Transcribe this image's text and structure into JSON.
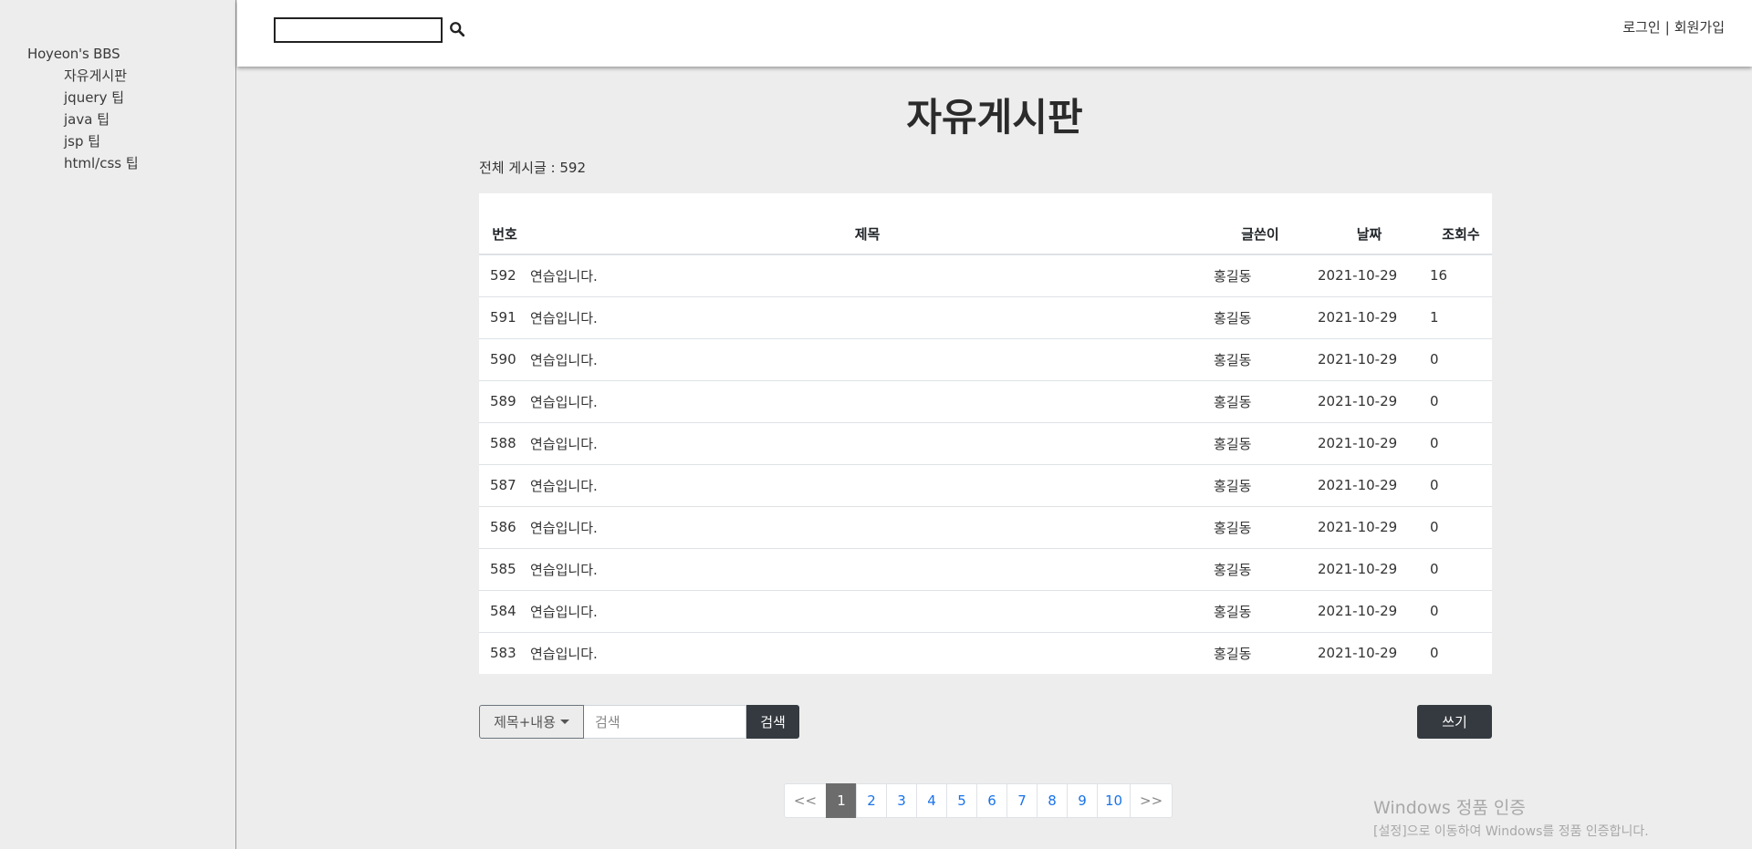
{
  "sidebar": {
    "brand": "Hoyeon's BBS",
    "items": [
      {
        "label": "자유게시판"
      },
      {
        "label": "jquery 팁"
      },
      {
        "label": "java 팁"
      },
      {
        "label": "jsp 팁"
      },
      {
        "label": "html/css 팁"
      }
    ]
  },
  "topbar": {
    "search_value": "",
    "login_label": "로그인",
    "separator": "|",
    "signup_label": "회원가입"
  },
  "main": {
    "title": "자유게시판",
    "total_label": "전체 게시글 : 592",
    "columns": {
      "num": "번호",
      "title": "제목",
      "writer": "글쓴이",
      "date": "날짜",
      "views": "조회수"
    },
    "rows": [
      {
        "num": "592",
        "title": "연습입니다.",
        "writer": "홍길동",
        "date": "2021-10-29",
        "views": "16"
      },
      {
        "num": "591",
        "title": "연습입니다.",
        "writer": "홍길동",
        "date": "2021-10-29",
        "views": "1"
      },
      {
        "num": "590",
        "title": "연습입니다.",
        "writer": "홍길동",
        "date": "2021-10-29",
        "views": "0"
      },
      {
        "num": "589",
        "title": "연습입니다.",
        "writer": "홍길동",
        "date": "2021-10-29",
        "views": "0"
      },
      {
        "num": "588",
        "title": "연습입니다.",
        "writer": "홍길동",
        "date": "2021-10-29",
        "views": "0"
      },
      {
        "num": "587",
        "title": "연습입니다.",
        "writer": "홍길동",
        "date": "2021-10-29",
        "views": "0"
      },
      {
        "num": "586",
        "title": "연습입니다.",
        "writer": "홍길동",
        "date": "2021-10-29",
        "views": "0"
      },
      {
        "num": "585",
        "title": "연습입니다.",
        "writer": "홍길동",
        "date": "2021-10-29",
        "views": "0"
      },
      {
        "num": "584",
        "title": "연습입니다.",
        "writer": "홍길동",
        "date": "2021-10-29",
        "views": "0"
      },
      {
        "num": "583",
        "title": "연습입니다.",
        "writer": "홍길동",
        "date": "2021-10-29",
        "views": "0"
      }
    ]
  },
  "search": {
    "select_label": "제목+내용",
    "placeholder": "검색",
    "button_label": "검색"
  },
  "write_button": "쓰기",
  "pagination": {
    "prev": "<<",
    "next": ">>",
    "pages": [
      "1",
      "2",
      "3",
      "4",
      "5",
      "6",
      "7",
      "8",
      "9",
      "10"
    ],
    "active": "1"
  },
  "watermark": {
    "line1": "Windows 정품 인증",
    "line2": "[설정]으로 이동하여 Windows를 정품 인증합니다."
  },
  "colors": {
    "background": "#ededed",
    "dark_button": "#343a40",
    "link": "#1a73e8",
    "active_page": "#6c6c6c"
  }
}
